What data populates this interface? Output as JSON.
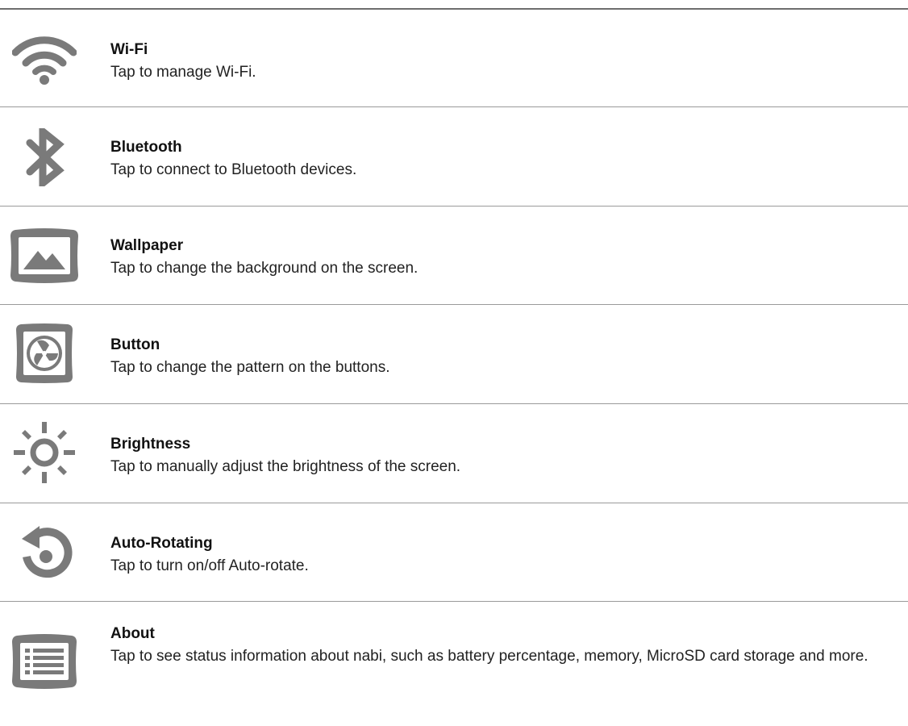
{
  "items": [
    {
      "title": "Wi-Fi",
      "description": "Tap to manage Wi-Fi.",
      "icon": "wifi-icon"
    },
    {
      "title": "Bluetooth",
      "description": "Tap to connect to Bluetooth devices.",
      "icon": "bluetooth-icon"
    },
    {
      "title": "Wallpaper",
      "description": "Tap to change the background on the screen.",
      "icon": "wallpaper-icon"
    },
    {
      "title": "Button",
      "description": "Tap to change the pattern on the buttons.",
      "icon": "button-pattern-icon"
    },
    {
      "title": "Brightness",
      "description": "Tap to manually adjust the brightness of the screen.",
      "icon": "brightness-icon"
    },
    {
      "title": "Auto-Rotating",
      "description": "Tap to turn on/off Auto-rotate.",
      "icon": "rotate-icon"
    },
    {
      "title": "About",
      "description": "Tap to see status information about nabi, such as battery percentage, memory, MicroSD card storage and more.",
      "icon": "list-icon"
    }
  ],
  "colors": {
    "icon": "#7a7a7a",
    "divider": "#9a9a9a",
    "text": "#1a1a1a"
  }
}
